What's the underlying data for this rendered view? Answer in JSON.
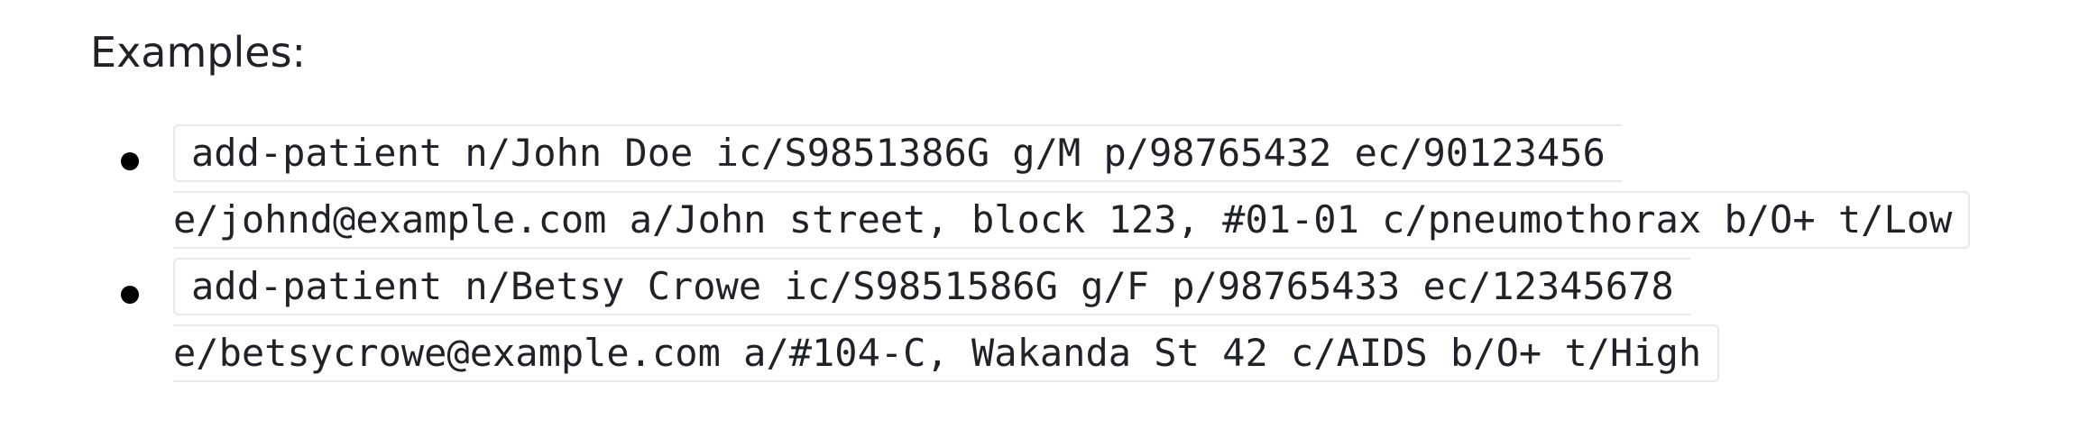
{
  "heading": "Examples:",
  "examples": [
    {
      "line1": "add-patient n/John Doe ic/S9851386G g/M p/98765432 ec/90123456",
      "line2": "e/johnd@example.com a/John street, block 123, #01-01 c/pneumothorax b/O+ t/Low"
    },
    {
      "line1": "add-patient n/Betsy Crowe ic/S9851586G g/F p/98765433 ec/12345678",
      "line2": "e/betsycrowe@example.com a/#104-C, Wakanda St 42 c/AIDS b/O+ t/High"
    }
  ]
}
